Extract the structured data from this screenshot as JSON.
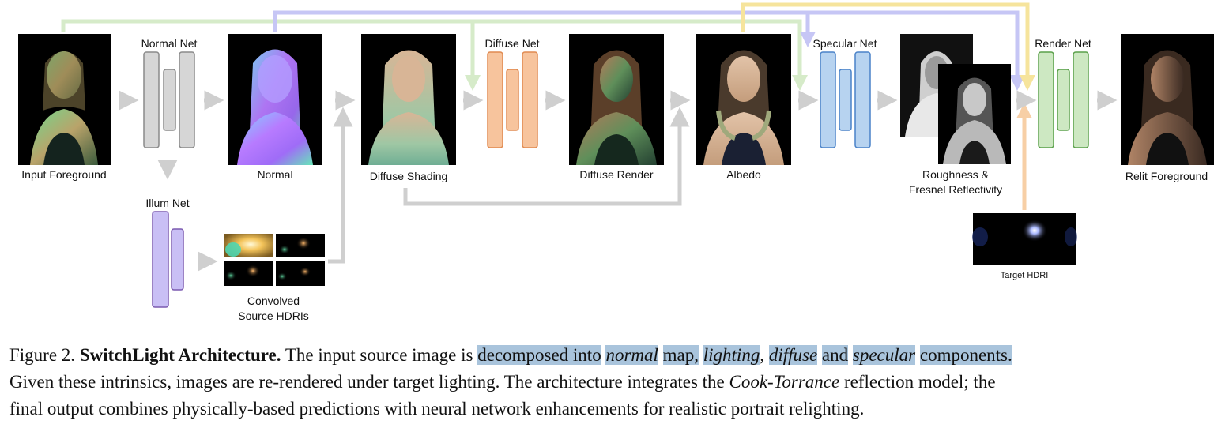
{
  "labels": {
    "input_foreground": "Input Foreground",
    "normal_net": "Normal Net",
    "normal": "Normal",
    "illum_net": "Illum Net",
    "convolved_1": "Convolved",
    "convolved_2": "Source HDRIs",
    "diffuse_shading": "Diffuse Shading",
    "diffuse_net": "Diffuse Net",
    "diffuse_render": "Diffuse Render",
    "albedo": "Albedo",
    "specular_net": "Specular Net",
    "roughness_1": "Roughness &",
    "roughness_2": "Fresnel Reflectivity",
    "target_hdri": "Target HDRI",
    "render_net": "Render Net",
    "relit_foreground": "Relit Foreground"
  },
  "caption": {
    "fig": "Figure 2.",
    "bold": "SwitchLight Architecture.",
    "t1": "The input source image is",
    "h1": "decomposed into",
    "i1": "normal",
    "h2": "map,",
    "i2": "lighting",
    "c1": ",",
    "i3": "diffuse",
    "h3": "and",
    "i4": "specular",
    "h4": "components.",
    "line2a": "Given these intrinsics, images are re-rendered under target lighting.  The architecture integrates the",
    "line2i": "Cook-Torrance",
    "line2b": "reflection model; the",
    "line3": "final output combines physically-based predictions with neural network enhancements for realistic portrait relighting."
  },
  "colors": {
    "normal_net": "#d6d6d6",
    "illum_net": "#c9bff5",
    "diffuse_net": "#f7c49d",
    "specular_net": "#b7d3f0",
    "render_net": "#cde8c2",
    "skip_green": "#d6ebc9",
    "skip_purple": "#c6c6f5",
    "skip_yellow": "#f6e49c",
    "skip_orange": "#f7cfa6",
    "arrow_gray": "#cfcfcf",
    "caption_highlight": "#a9c4dc"
  }
}
